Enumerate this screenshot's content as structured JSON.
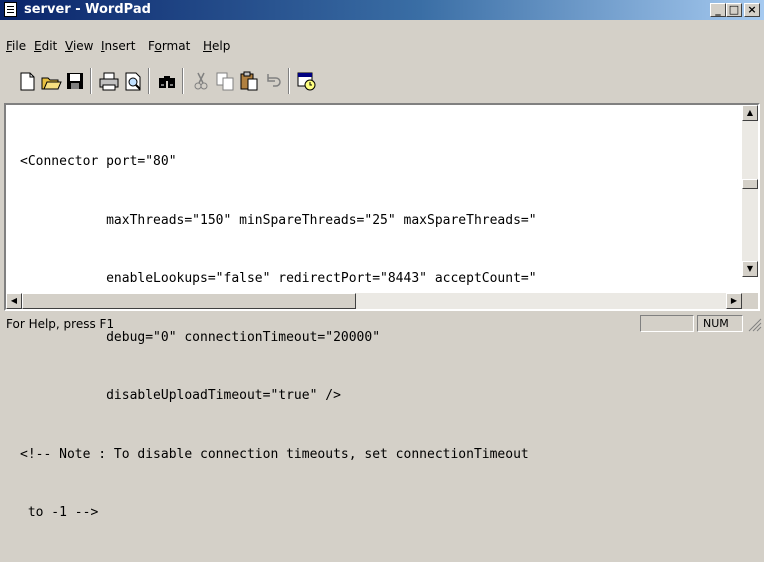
{
  "window": {
    "title": "server - WordPad"
  },
  "caption_buttons": {
    "minimize": "_",
    "maximize": "□",
    "close": "×"
  },
  "menu": [
    {
      "label": "File",
      "key": "F",
      "rest": "ile"
    },
    {
      "label": "Edit",
      "key": "E",
      "rest": "dit"
    },
    {
      "label": "View",
      "key": "V",
      "rest": "iew"
    },
    {
      "label": "Insert",
      "key": "I",
      "rest": "nsert"
    },
    {
      "label": "Format",
      "key": "o",
      "pre": "F",
      "rest": "rmat"
    },
    {
      "label": "Help",
      "key": "H",
      "rest": "elp"
    }
  ],
  "toolbar": {
    "buttons": [
      "new-icon",
      "open-icon",
      "save-icon",
      "print-icon",
      "print-preview-icon",
      "find-icon",
      "cut-icon",
      "copy-icon",
      "paste-icon",
      "undo-icon",
      "insert-date-time-icon"
    ]
  },
  "document": {
    "lines": [
      "<Connector port=\"80\"",
      "           maxThreads=\"150\" minSpareThreads=\"25\" maxSpareThreads=\"",
      "           enableLookups=\"false\" redirectPort=\"8443\" acceptCount=\"",
      "           debug=\"0\" connectionTimeout=\"20000\"",
      "           disableUploadTimeout=\"true\" />",
      "<!-- Note : To disable connection timeouts, set connectionTimeout",
      " to -1 -->"
    ]
  },
  "status": {
    "help": "For Help, press F1",
    "num": "NUM"
  }
}
